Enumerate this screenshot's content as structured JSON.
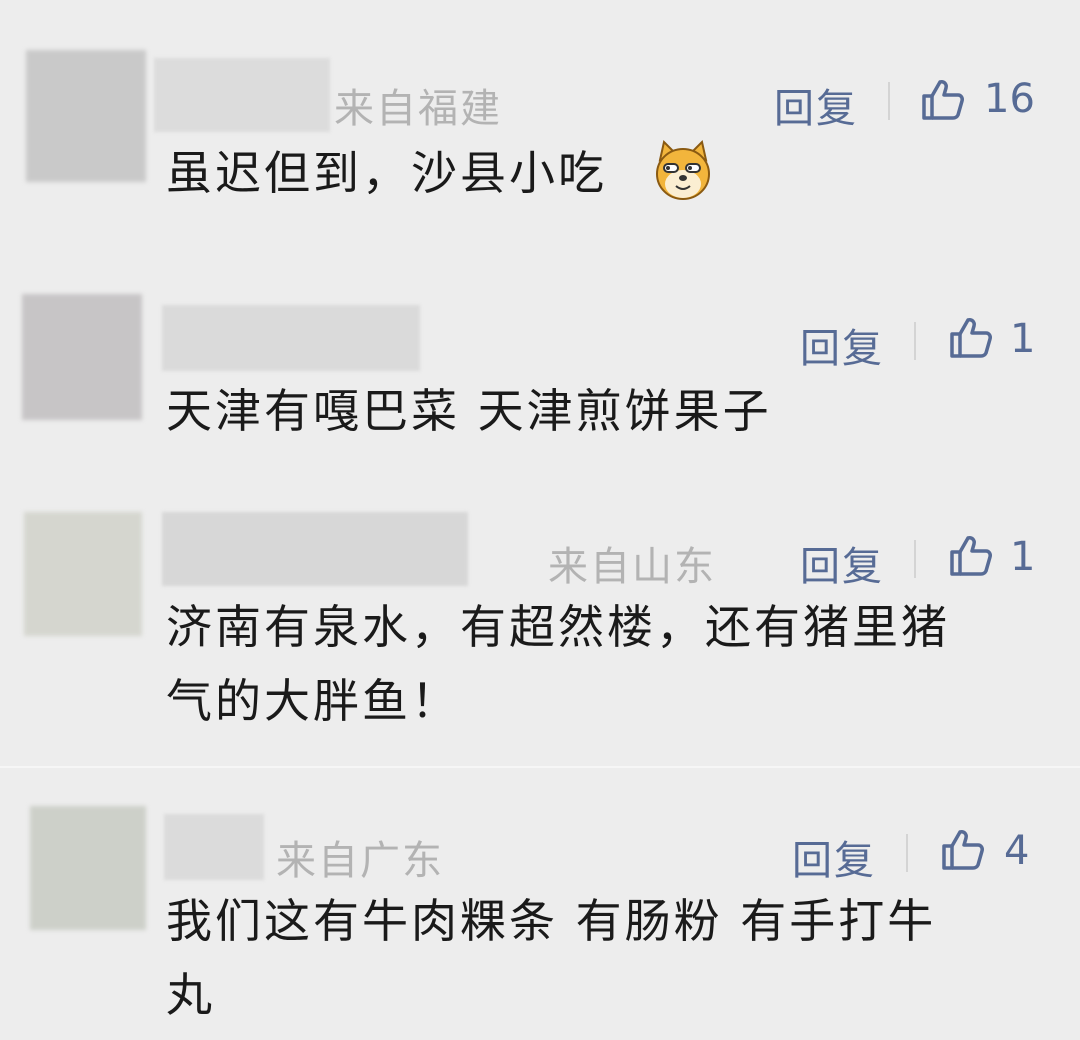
{
  "comments": [
    {
      "location": "来自福建",
      "reply_label": "回复",
      "likes": "16",
      "text": "虽迟但到，沙县小吃",
      "emoji": "doge-emoji-icon"
    },
    {
      "location": "",
      "reply_label": "回复",
      "likes": "1",
      "text": "天津有嘎巴菜 天津煎饼果子"
    },
    {
      "location": "来自山东",
      "reply_label": "回复",
      "likes": "1",
      "text_line1": "济南有泉水，有超然楼，还有猪里猪",
      "text_line2": "气的大胖鱼！"
    },
    {
      "location": "来自广东",
      "reply_label": "回复",
      "likes": "4",
      "text_line1": "我们这有牛肉粿条 有肠粉 有手打牛",
      "text_line2": "丸"
    }
  ],
  "colors": {
    "background": "#ededed",
    "link": "#576b95",
    "meta": "#b3b3b3",
    "text": "#1a1a1a"
  }
}
